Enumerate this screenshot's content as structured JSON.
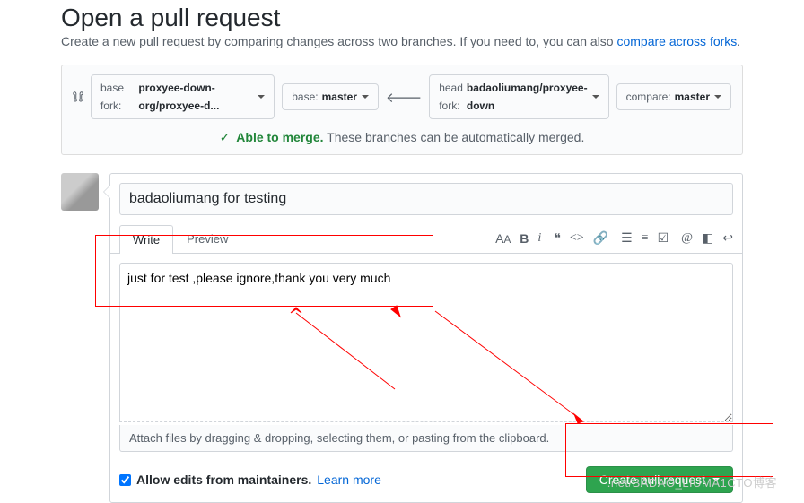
{
  "header": {
    "title": "Open a pull request",
    "subtitle_pre": "Create a new pull request by comparing changes across two branches. If you need to, you can also ",
    "subtitle_link": "compare across forks",
    "subtitle_post": "."
  },
  "compare": {
    "base_fork_label": "base fork:",
    "base_fork_value": "proxyee-down-org/proxyee-d...",
    "base_label": "base:",
    "base_value": "master",
    "head_fork_label": "head fork:",
    "head_fork_value": "badaoliumang/proxyee-down",
    "compare_label": "compare:",
    "compare_value": "master"
  },
  "merge": {
    "check": "✓",
    "status": "Able to merge.",
    "message": "These branches can be automatically merged."
  },
  "editor": {
    "title_value": "badaoliumang for testing",
    "tab_write": "Write",
    "tab_preview": "Preview",
    "body_value": "just for test ,please ignore,thank you very much",
    "attach_hint": "Attach files by dragging & dropping, selecting them, or pasting from the clipboard."
  },
  "footer": {
    "allow_edits": "Allow edits from maintainers.",
    "learn_more": "Learn more",
    "create_button": "Create pull request"
  },
  "watermark": ".net/BADAO_LIUMA1CTO博客"
}
